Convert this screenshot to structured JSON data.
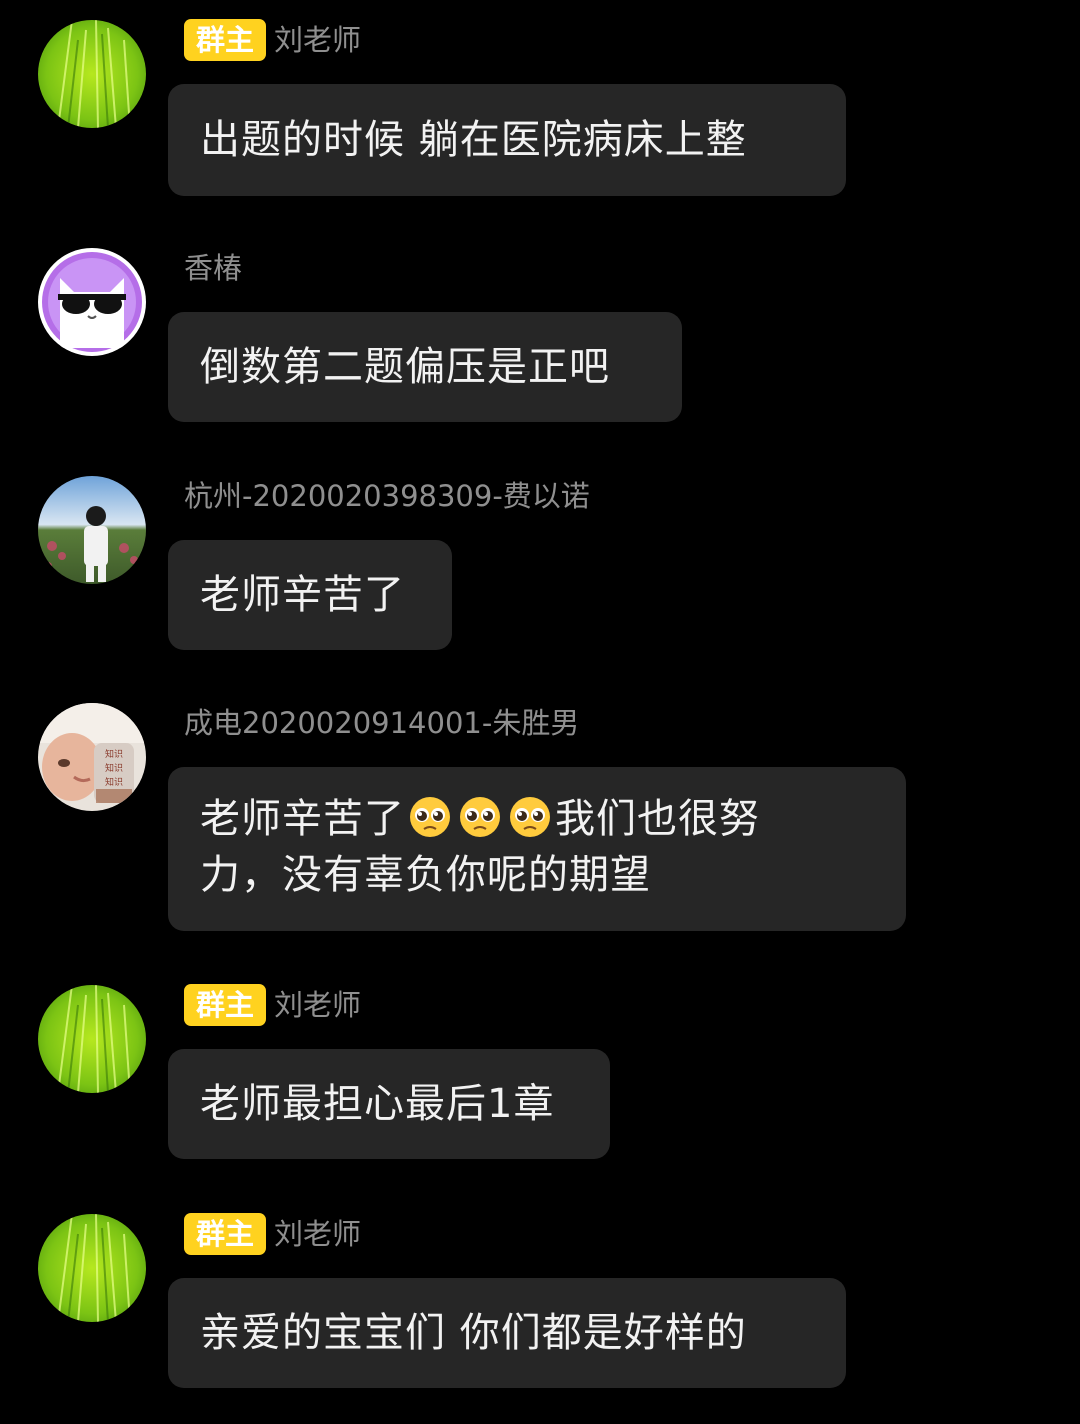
{
  "messages": [
    {
      "sender": "刘老师",
      "badge": "群主",
      "avatar_icon": "grass-avatar",
      "text": "出题的时候  躺在医院病床上整"
    },
    {
      "sender": "香椿",
      "badge": "",
      "avatar_icon": "cat-sunglasses-avatar",
      "text": "倒数第二题偏压是正吧"
    },
    {
      "sender": "杭州-2020020398309-费以诺",
      "badge": "",
      "avatar_icon": "person-photo-avatar",
      "text": "老师辛苦了"
    },
    {
      "sender": "成电2020020914001-朱胜男",
      "badge": "",
      "avatar_icon": "child-photo-avatar",
      "text_line1_a": "老师辛苦了",
      "emoji": "pleading-face-emoji",
      "text_line1_b": "我们也很努",
      "text_line2": "力，没有辜负你呢的期望"
    },
    {
      "sender": "刘老师",
      "badge": "群主",
      "avatar_icon": "grass-avatar",
      "text": "老师最担心最后1章"
    },
    {
      "sender": "刘老师",
      "badge": "群主",
      "avatar_icon": "grass-avatar",
      "text": "亲爱的宝宝们  你们都是好样的"
    }
  ],
  "colors": {
    "background": "#000000",
    "bubble": "#262626",
    "badge": "#ffd21f",
    "name": "#8f8f8f",
    "text": "#f2f2f2"
  }
}
